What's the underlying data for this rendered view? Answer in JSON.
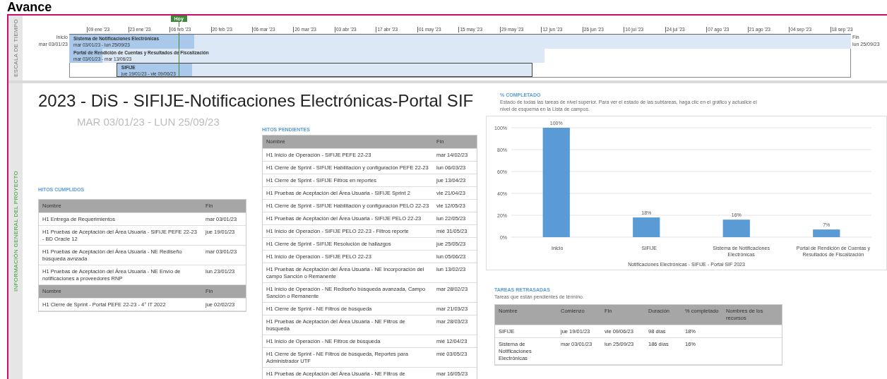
{
  "page_title": "Avance",
  "timeline": {
    "side_label": "ESCALA DE TIEMPO",
    "today_label": "Hoy",
    "start": {
      "label": "Inicio",
      "date": "mar 03/01/23"
    },
    "end": {
      "label": "Fin",
      "date": "lun 25/09/23"
    },
    "ticks": [
      "09 ene '23",
      "23 ene '23",
      "06 feb '23",
      "20 feb '23",
      "06 mar '23",
      "20 mar '23",
      "03 abr '23",
      "17 abr '23",
      "01 may '23",
      "15 may '23",
      "29 may '23",
      "12 jun '23",
      "26 jun '23",
      "10 jul '23",
      "24 jul '23",
      "07 ago '23",
      "21 ago '23",
      "04 sep '23",
      "18 sep '23"
    ],
    "bars": [
      {
        "name": "Sistema de Notificaciones Electrónicas",
        "dates": "mar 03/01/23 - lun 25/09/23",
        "level": 0.16,
        "outlined": false
      },
      {
        "name": "Portal de Rendición de Cuentas y Resultados de Fiscalización",
        "dates": "mar 03/01/23 - mar 13/06/23",
        "level": 0.07,
        "outlined": false
      },
      {
        "name": "SIFIJE",
        "dates": "jue 19/01/23 - vie 09/06/23",
        "level": 0.18,
        "outlined": true
      }
    ]
  },
  "project": {
    "side_label": "INFORMACIÓN GENERAL DEL PROYECTO",
    "title": "2023 - DiS - SIFIJE-Notificaciones Electrónicas-Portal SIF",
    "dates": "MAR 03/01/23 - LUN 25/09/23"
  },
  "hitos_cumplidos": {
    "title": "HITOS CUMPLIDOS",
    "columns": [
      "Nombre",
      "Fin"
    ],
    "rows": [
      [
        "H1 Entrega de Requerimientos",
        "mar 03/01/23"
      ],
      [
        "H1 Pruebas de Aceptación del Área Usuaria - SIFIJE PEFE 22-23 - BD Oracle 12",
        "jue 19/01/23"
      ],
      [
        "H1 Pruebas de Aceptación del Área Usuaria - NE Rediseño búsqueda avnzada",
        "mar 03/01/23"
      ],
      [
        "H1 Pruebas de Aceptación del Área Usuaria - NE Envío de notificaciones a proveedores RNP",
        "lun 23/01/23"
      ]
    ],
    "second_columns": [
      "Nombre",
      "Fin"
    ],
    "more_rows": [
      [
        "H1 Cierre de Sprint - Portal PEFE 22-23 - 4° IT 2022",
        "jue 02/02/23"
      ]
    ]
  },
  "hitos_pendientes": {
    "title": "HITOS PENDIENTES",
    "columns": [
      "Nombre",
      "Fin"
    ],
    "rows": [
      [
        "H1 Inicio de Operación - SIFIJE PEFE 22-23",
        "mar 14/02/23"
      ],
      [
        "H1 Cierre de Sprint - SIFIJE Habilitación y configuración PEFE 22-23",
        "lun 06/03/23"
      ],
      [
        "H1 Cierre de Sprint - SIFIJE Filtros en reportes",
        "jue 13/04/23"
      ],
      [
        "H1 Pruebas de Aceptación del Área Usuaria - SIFIJE Sprint 2",
        "vie 21/04/23"
      ],
      [
        "H1 Cierre de Sprint - SIFIJE Habilitación y configuración PELO 22-23",
        "vie 12/05/23"
      ],
      [
        "H1 Pruebas de Aceptación del Área Usuaria - SIFIJE PELO 22-23",
        "lun 22/05/23"
      ],
      [
        "H1 Inicio de Operación - SIFIJE PELO 22-23 - Filtros reporte",
        "mié 31/05/23"
      ],
      [
        "H1 Cierre de Sprint - SIFIJE Resolución de hallazgos",
        "jue 25/05/23"
      ],
      [
        "H1 Inicio de Operación - SIFIJE PELO 22-23",
        "lun 05/06/23"
      ],
      [
        "H1 Pruebas de Aceptación del Área Usuaria - NE Incorporación del campo Sanción o Remanente",
        "lun 13/02/23"
      ],
      [
        "H1 Inicio de Operación - NE Rediseño búsqueda avanzada, Campo Sanción o Remanente",
        "mar 28/02/23"
      ],
      [
        "H1 Cierre de Sprint - NE Filtros de búsqueda",
        "mar 21/03/23"
      ],
      [
        "H1 Pruebas de Aceptación del Área Usuaria - NE Filtros de búsqueda",
        "mar 28/03/23"
      ],
      [
        "H1 Inicio de Operación - NE Filtros de búsqueda",
        "mié 12/04/23"
      ],
      [
        "H1 Cierre de Sprint - NE Filtros de búsqueda, Reportes para Administrador UTF",
        "mié 03/05/23"
      ],
      [
        "H1 Pruebas de Aceptación del Área Usuaria - NE Filtros de",
        "mar 16/05/23"
      ]
    ]
  },
  "percent_complete": {
    "title": "% COMPLETADO",
    "description": "Estado de todas las tareas de nivel superior. Para ver el estado de las subtareas, haga clic en el gráfico y actualice el nivel de esquema en la Lista de campos.",
    "chart_data": {
      "type": "bar",
      "xlabel": "Notificaciones Electrónicas - SIFIJE - Portal SIF 2023",
      "categories": [
        "Inicio",
        "SIFIJE",
        "Sistema de Notificaciones Electrónicas",
        "Portal de Rendición de Cuentas y Resultados de Fiscalización"
      ],
      "series": [
        {
          "color": "#5b9bd5",
          "values": [
            100,
            18,
            16,
            7
          ]
        }
      ],
      "grid": true,
      "ylim": [
        0,
        100
      ],
      "yticks": [
        {
          "value": 0,
          "label": "0%"
        },
        {
          "value": 20,
          "label": "20%"
        },
        {
          "value": 40,
          "label": "40%"
        },
        {
          "value": 60,
          "label": "60%"
        },
        {
          "value": 80,
          "label": "80%"
        },
        {
          "value": 100,
          "label": "100%"
        }
      ],
      "value_labels": [
        "100%",
        "18%",
        "16%",
        "7%"
      ]
    }
  },
  "tareas_retrasadas": {
    "title": "TAREAS RETRASADAS",
    "subtitle": "Tareas que están pendientes de término.",
    "columns": [
      "Nombre",
      "Comienzo",
      "Fin",
      "Duración",
      "% completado",
      "Nombres de los recursos"
    ],
    "rows": [
      [
        "SIFIJE",
        "jue 19/01/23",
        "vie 09/06/23",
        "98 días",
        "18%"
      ],
      [
        "Sistema de Notificaciones Electrónicas",
        "mar 03/01/23",
        "lun 25/09/23",
        "186 días",
        "16%"
      ]
    ]
  }
}
